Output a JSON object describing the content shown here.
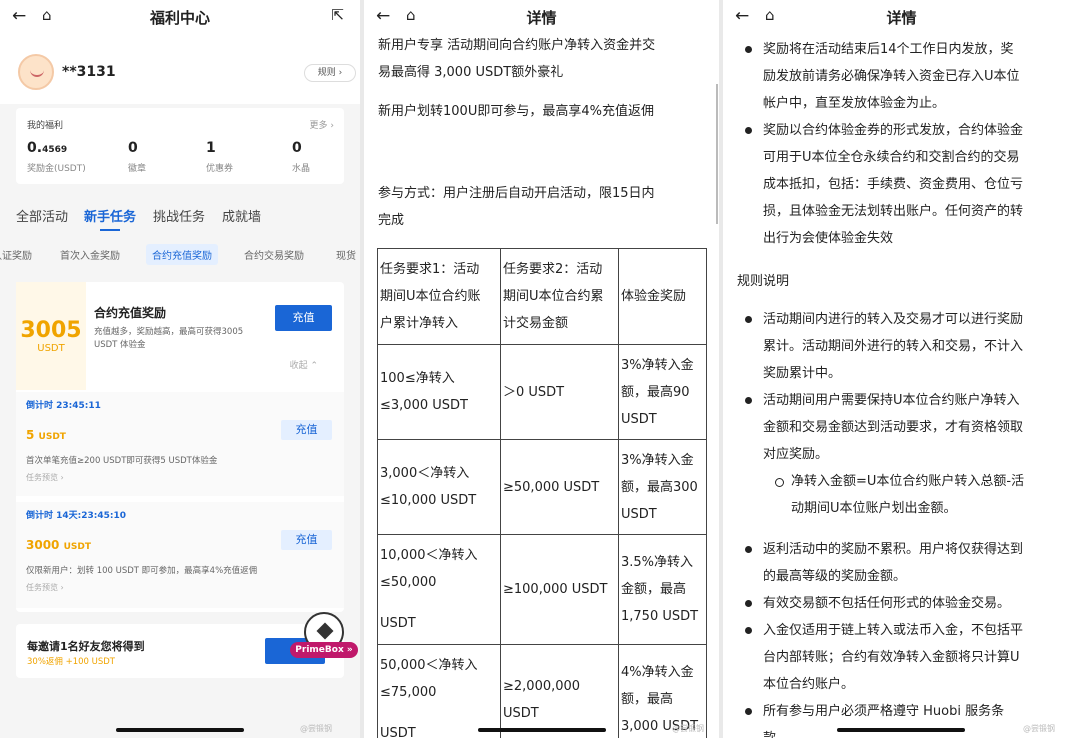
{
  "p1": {
    "title": "福利中心",
    "username": "**3131",
    "rules": "规则 ›",
    "benefits": {
      "title": "我的福利",
      "more": "更多 ›",
      "stats": [
        {
          "value": "0.",
          "small": "4569",
          "label": "奖励金(USDT)"
        },
        {
          "value": "0",
          "small": "",
          "label": "徽章"
        },
        {
          "value": "1",
          "small": "",
          "label": "优惠券"
        },
        {
          "value": "0",
          "small": "",
          "label": "水晶"
        }
      ]
    },
    "tabs": [
      "全部活动",
      "新手任务",
      "挑战任务",
      "成就墙"
    ],
    "chips": [
      "认证奖励",
      "首次入金奖励",
      "合约充值奖励",
      "合约交易奖励",
      "现货"
    ],
    "main": {
      "amount": "3005",
      "unit": "USDT",
      "heading": "合约充值奖励",
      "desc": "充值越多，奖励越高，最高可获得3005 USDT 体验金",
      "button": "充值",
      "collapse": "收起 ⌃"
    },
    "sub1": {
      "countdown": "倒计时 23:45:11",
      "amount": "5",
      "unit": "USDT",
      "desc": "首次单笔充值≥200 USDT即可获得5 USDT体验金",
      "review": "任务预览 ›",
      "button": "充值"
    },
    "sub2": {
      "countdown": "倒计时 14天:23:45:10",
      "amount": "3000",
      "unit": "USDT",
      "desc": "仅限新用户：划转 100 USDT 即可参加，最高享4%充值返佣",
      "review": "任务预览 ›",
      "button": "充值"
    },
    "invite": {
      "title": "每邀请1名好友您将得到",
      "reward": "30%返佣 +100 USDT",
      "badge": "PrimeBox »"
    },
    "watermark": "@尝锻钢"
  },
  "p2": {
    "title": "详情",
    "para1": [
      "新用户专享 活动期间向合约账户净转入资金并交",
      "易最高得 3,000 USDT额外豪礼"
    ],
    "para2": "新用户划转100U即可参与，最高享4%充值返佣",
    "para3": [
      "参与方式：用户注册后自动开启活动，限15日内",
      "完成"
    ],
    "table": {
      "headers": [
        [
          "任务要求1：活动",
          "期间U本位合约账",
          "户累计净转入"
        ],
        [
          "任务要求2：活动",
          "期间U本位合约累",
          "计交易金额"
        ],
        [
          "体验金奖励"
        ]
      ],
      "rows": [
        [
          [
            "100≤净转入",
            "≤3,000 USDT"
          ],
          [
            "＞0 USDT"
          ],
          [
            "3%净转入金",
            "额，最高90",
            "USDT"
          ]
        ],
        [
          [
            "3,000＜净转入",
            "≤10,000 USDT"
          ],
          [
            "≥50,000 USDT"
          ],
          [
            "3%净转入金",
            "额，最高300",
            "USDT"
          ]
        ],
        [
          [
            "10,000＜净转入",
            "≤50,000",
            "",
            "USDT"
          ],
          [
            "≥100,000 USDT"
          ],
          [
            "3.5%净转入",
            "金额，最高",
            "1,750 USDT"
          ]
        ],
        [
          [
            "50,000＜净转入",
            "≤75,000",
            "",
            "USDT"
          ],
          [
            "≥2,000,000",
            "USDT"
          ],
          [
            "4%净转入金",
            "额，最高",
            "3,000 USDT"
          ]
        ]
      ]
    },
    "watermark": "@尝锻钢"
  },
  "p3": {
    "title": "详情",
    "top": [
      [
        "奖励将在活动结束后14个工作日内发放，奖",
        "励发放前请务必确保净转入资金已存入U本位",
        "帐户中，直至发放体验金为止。"
      ],
      [
        "奖励以合约体验金券的形式发放，合约体验金",
        "可用于U本位全仓永续合约和交割合约的交易",
        "成本抵扣，包括：手续费、资金费用、仓位亏",
        "损，且体验金无法划转出账户。任何资产的转",
        "出行为会使体验金失效"
      ]
    ],
    "section": "规则说明",
    "rules": [
      [
        "活动期间内进行的转入及交易才可以进行奖励",
        "累计。活动期间外进行的转入和交易，不计入",
        "奖励累计中。"
      ],
      [
        "活动期间用户需要保持U本位合约账户净转入",
        "金额和交易金额达到活动要求，才有资格领取",
        "对应奖励。"
      ]
    ],
    "sub": [
      "净转入金额=U本位合约账户转入总额-活",
      "动期间U本位账户划出金额。"
    ],
    "rules2": [
      [
        "返利活动中的奖励不累积。用户将仅获得达到",
        "的最高等级的奖励金额。"
      ],
      [
        "有效交易额不包括任何形式的体验金交易。"
      ],
      [
        "入金仅适用于链上转入或法币入金，不包括平",
        "台内部转账；合约有效净转入金额将只计算U",
        "本位合约账户。"
      ],
      [
        "所有参与用户必须严格遵守 Huobi  服务条",
        "款"
      ]
    ],
    "watermark": "@尝锻钢"
  }
}
